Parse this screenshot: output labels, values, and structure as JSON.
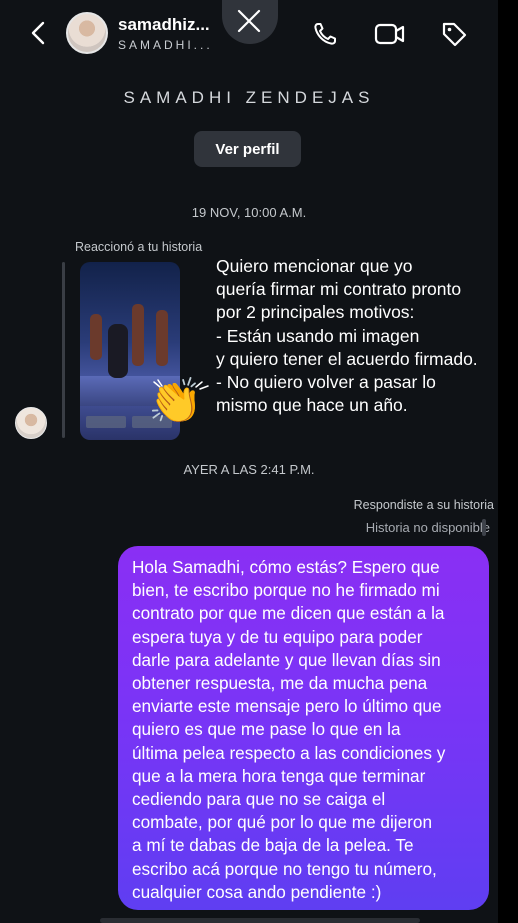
{
  "header": {
    "name": "samadhiz...",
    "username": "SAMADHI...",
    "icons": [
      "back-icon",
      "close-icon",
      "phone-icon",
      "video-icon",
      "tag-icon"
    ]
  },
  "profile": {
    "display_name": "SAMADHI ZENDEJAS",
    "view_profile_label": "Ver perfil"
  },
  "thread": {
    "timestamp1": "19 NOV, 10:00 A.M.",
    "reaction_label": "Reaccionó a tu historia",
    "reaction_sticker": "👏",
    "incoming_message": "Quiero mencionar que yo\nquería firmar mi contrato pronto\npor 2 principales motivos:\n- Están usando mi imagen\ny quiero tener el acuerdo firmado.\n- No quiero volver a pasar lo\nmismo que hace un año.",
    "timestamp2": "AYER A LAS 2:41 P.M.",
    "replied_label": "Respondiste a su historia",
    "story_unavailable": "Historia no disponible",
    "outgoing_message": "Hola Samadhi, cómo estás? Espero que\nbien, te escribo porque no he firmado mi\ncontrato por que me dicen que están a la\nespera tuya y de tu equipo para poder\ndarle para adelante y que llevan días sin\nobtener respuesta, me da mucha pena\nenviarte este mensaje pero lo último que\nquiero es que me pase lo que en la\núltima pelea respecto a las condiciones y\nque a la mera hora tenga que terminar\ncediendo para que no se caiga el\ncombate, por qué por lo que me dijeron\na mí te dabas de baja de la pelea. Te\nescribo acá porque no tengo tu número,\ncualquier cosa ando pendiente :)"
  },
  "colors": {
    "background": "#0f1216",
    "bubble_start": "#8a2ff4",
    "bubble_end": "#5f3ef2",
    "muted_text": "#c4c8cc"
  }
}
